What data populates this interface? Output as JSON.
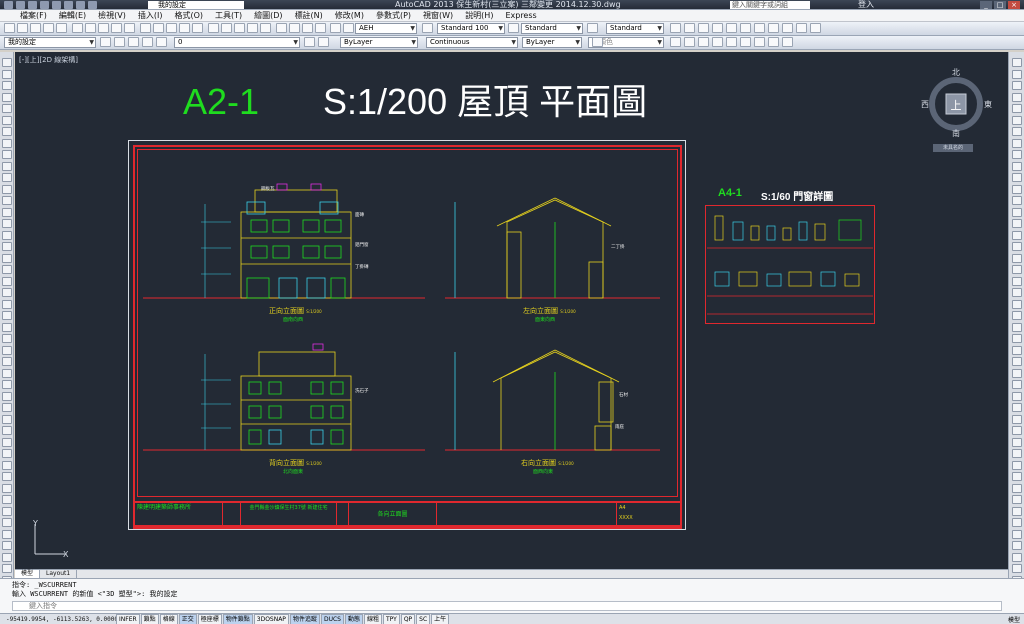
{
  "titlebar": {
    "workspace": "我的設定",
    "title": "AutoCAD 2013   保生新村(三立案) 三鄰變更 2014.12.30.dwg",
    "search_placeholder": "鍵入關鍵字或詞組",
    "login": "登入"
  },
  "menu": [
    "檔案(F)",
    "編輯(E)",
    "檢視(V)",
    "插入(I)",
    "格式(O)",
    "工具(T)",
    "繪圖(D)",
    "標註(N)",
    "修改(M)",
    "參數式(P)",
    "視窗(W)",
    "說明(H)",
    "Express"
  ],
  "toolbar1": {
    "text_style": "AEH",
    "dim_style": "Standard 100",
    "table_style": "Standard",
    "mleader_style": "Standard"
  },
  "toolbar2": {
    "workspace": "我的設定",
    "layer": "0",
    "color": "ByLayer",
    "linetype": "Continuous",
    "lineweight": "ByLayer",
    "plotstyle": "依顏色"
  },
  "viewport": {
    "label": "[-][上][2D 線架構]",
    "sheet_id": "A2-1",
    "sheet_title": "S:1/200  屋頂 平面圖",
    "detail_id": "A4-1",
    "detail_title": "S:1/60 門窗詳圖"
  },
  "elevations": [
    {
      "caption": "正向立面圖",
      "scale": "S:1/200",
      "sub": "面南向西"
    },
    {
      "caption": "左向立面圖",
      "scale": "S:1/200",
      "sub": "面東向西"
    },
    {
      "caption": "背向立面圖",
      "scale": "S:1/200",
      "sub": "北向面東"
    },
    {
      "caption": "右向立面圖",
      "scale": "S:1/200",
      "sub": "面西向東"
    }
  ],
  "notes": [
    "鋼板瓦",
    "面磚",
    "鋁門窗",
    "丁掛磚",
    "二丁掛",
    "洗石子",
    "石材",
    "雨庇"
  ],
  "titleblock": {
    "firm": "陳建明建築師事務所",
    "project": "金門縣金沙鎮保生村37號 新建住宅",
    "drawing": "各向立面圖",
    "sheet_no": "A4",
    "date": "XXXX"
  },
  "navcube": {
    "north": "北",
    "south": "南",
    "east": "東",
    "west": "西",
    "face": "上",
    "wcs": "未具名的"
  },
  "ucs": {
    "x": "X",
    "y": "Y"
  },
  "layout_tabs": [
    "模型",
    "Layout1"
  ],
  "command": {
    "line1": "指令: _WSCURRENT",
    "line2": "輸入 WSCURRENT 的新值 <\"3D 塑型\">: 我的設定",
    "placeholder": "鍵入指令"
  },
  "status": {
    "coords": "-95419.9954, -6113.5263, 0.0000",
    "toggles": [
      "INFER",
      "鎖點",
      "格線",
      "正交",
      "極座標",
      "物件鎖點",
      "3DOSNAP",
      "物件追蹤",
      "DUCS",
      "動態",
      "線粗",
      "TPY",
      "QP",
      "SC",
      "上午"
    ],
    "active": [
      "正交",
      "物件鎖點",
      "物件追蹤",
      "DUCS",
      "動態"
    ],
    "model": "模型"
  },
  "colors": {
    "canvas": "#232a35",
    "frame": "#e0282e",
    "green": "#1fdc1f",
    "yellow": "#e6d21e",
    "cyan": "#3ad0e8",
    "magenta": "#e02ee0"
  }
}
